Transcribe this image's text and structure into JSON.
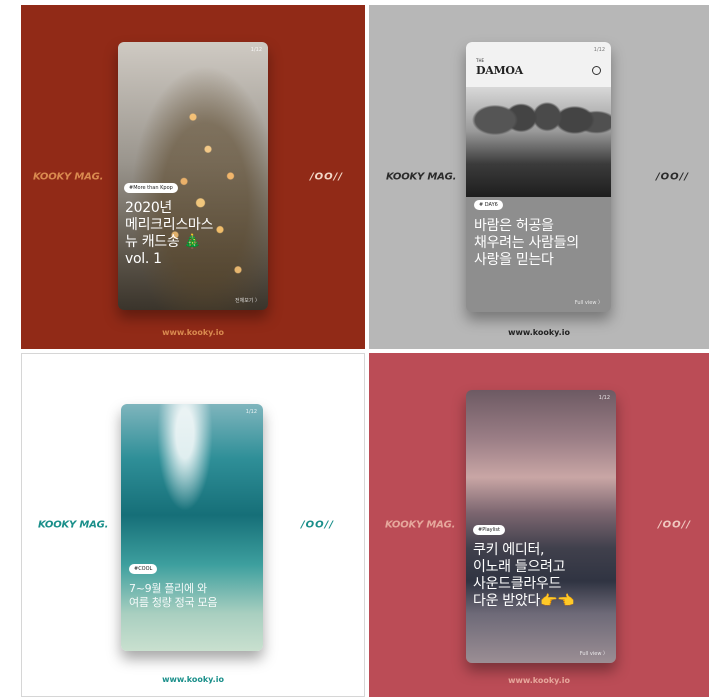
{
  "tiles": [
    {
      "brand": "KOOKY MAG.",
      "mark": "/OO//",
      "site": "www.kooky.io",
      "card": {
        "page": "1/12",
        "tag": "#More than Kpop",
        "headline": "2020년\n메리크리스마스\n뉴 캐드송 🎄\nvol. 1",
        "footer": "전체보기 〉"
      }
    },
    {
      "brand": "KOOKY MAG.",
      "mark": "/OO//",
      "site": "www.kooky.io",
      "card": {
        "page": "1/12",
        "magazine_small": "THE",
        "magazine_title": "DAMOA",
        "tag": "# DAY6",
        "headline": "바람은 허공을\n채우려는 사람들의\n사랑을 믿는다",
        "footer": "Full view 〉"
      }
    },
    {
      "brand": "KOOKY MAG.",
      "mark": "/OO//",
      "site": "www.kooky.io",
      "card": {
        "page": "1/12",
        "tag": "#COOL",
        "headline": "7~9월 플리에 와\n여름 청량 정국 모음"
      }
    },
    {
      "brand": "KOOKY MAG.",
      "mark": "/OO//",
      "site": "www.kooky.io",
      "card": {
        "page": "1/12",
        "tag": "#Playlist",
        "headline": "쿠키 에디터,\n이노래 들으려고\n사운드클라우드\n다운 받았다👉👈",
        "footer": "Full view 〉"
      }
    }
  ],
  "colors": {
    "tile1_bg": "#912a17",
    "tile2_bg": "#b7b7b7",
    "tile3_bg": "#ffffff",
    "tile4_bg": "#bb4c56",
    "teal_accent": "#1a8f8a"
  }
}
